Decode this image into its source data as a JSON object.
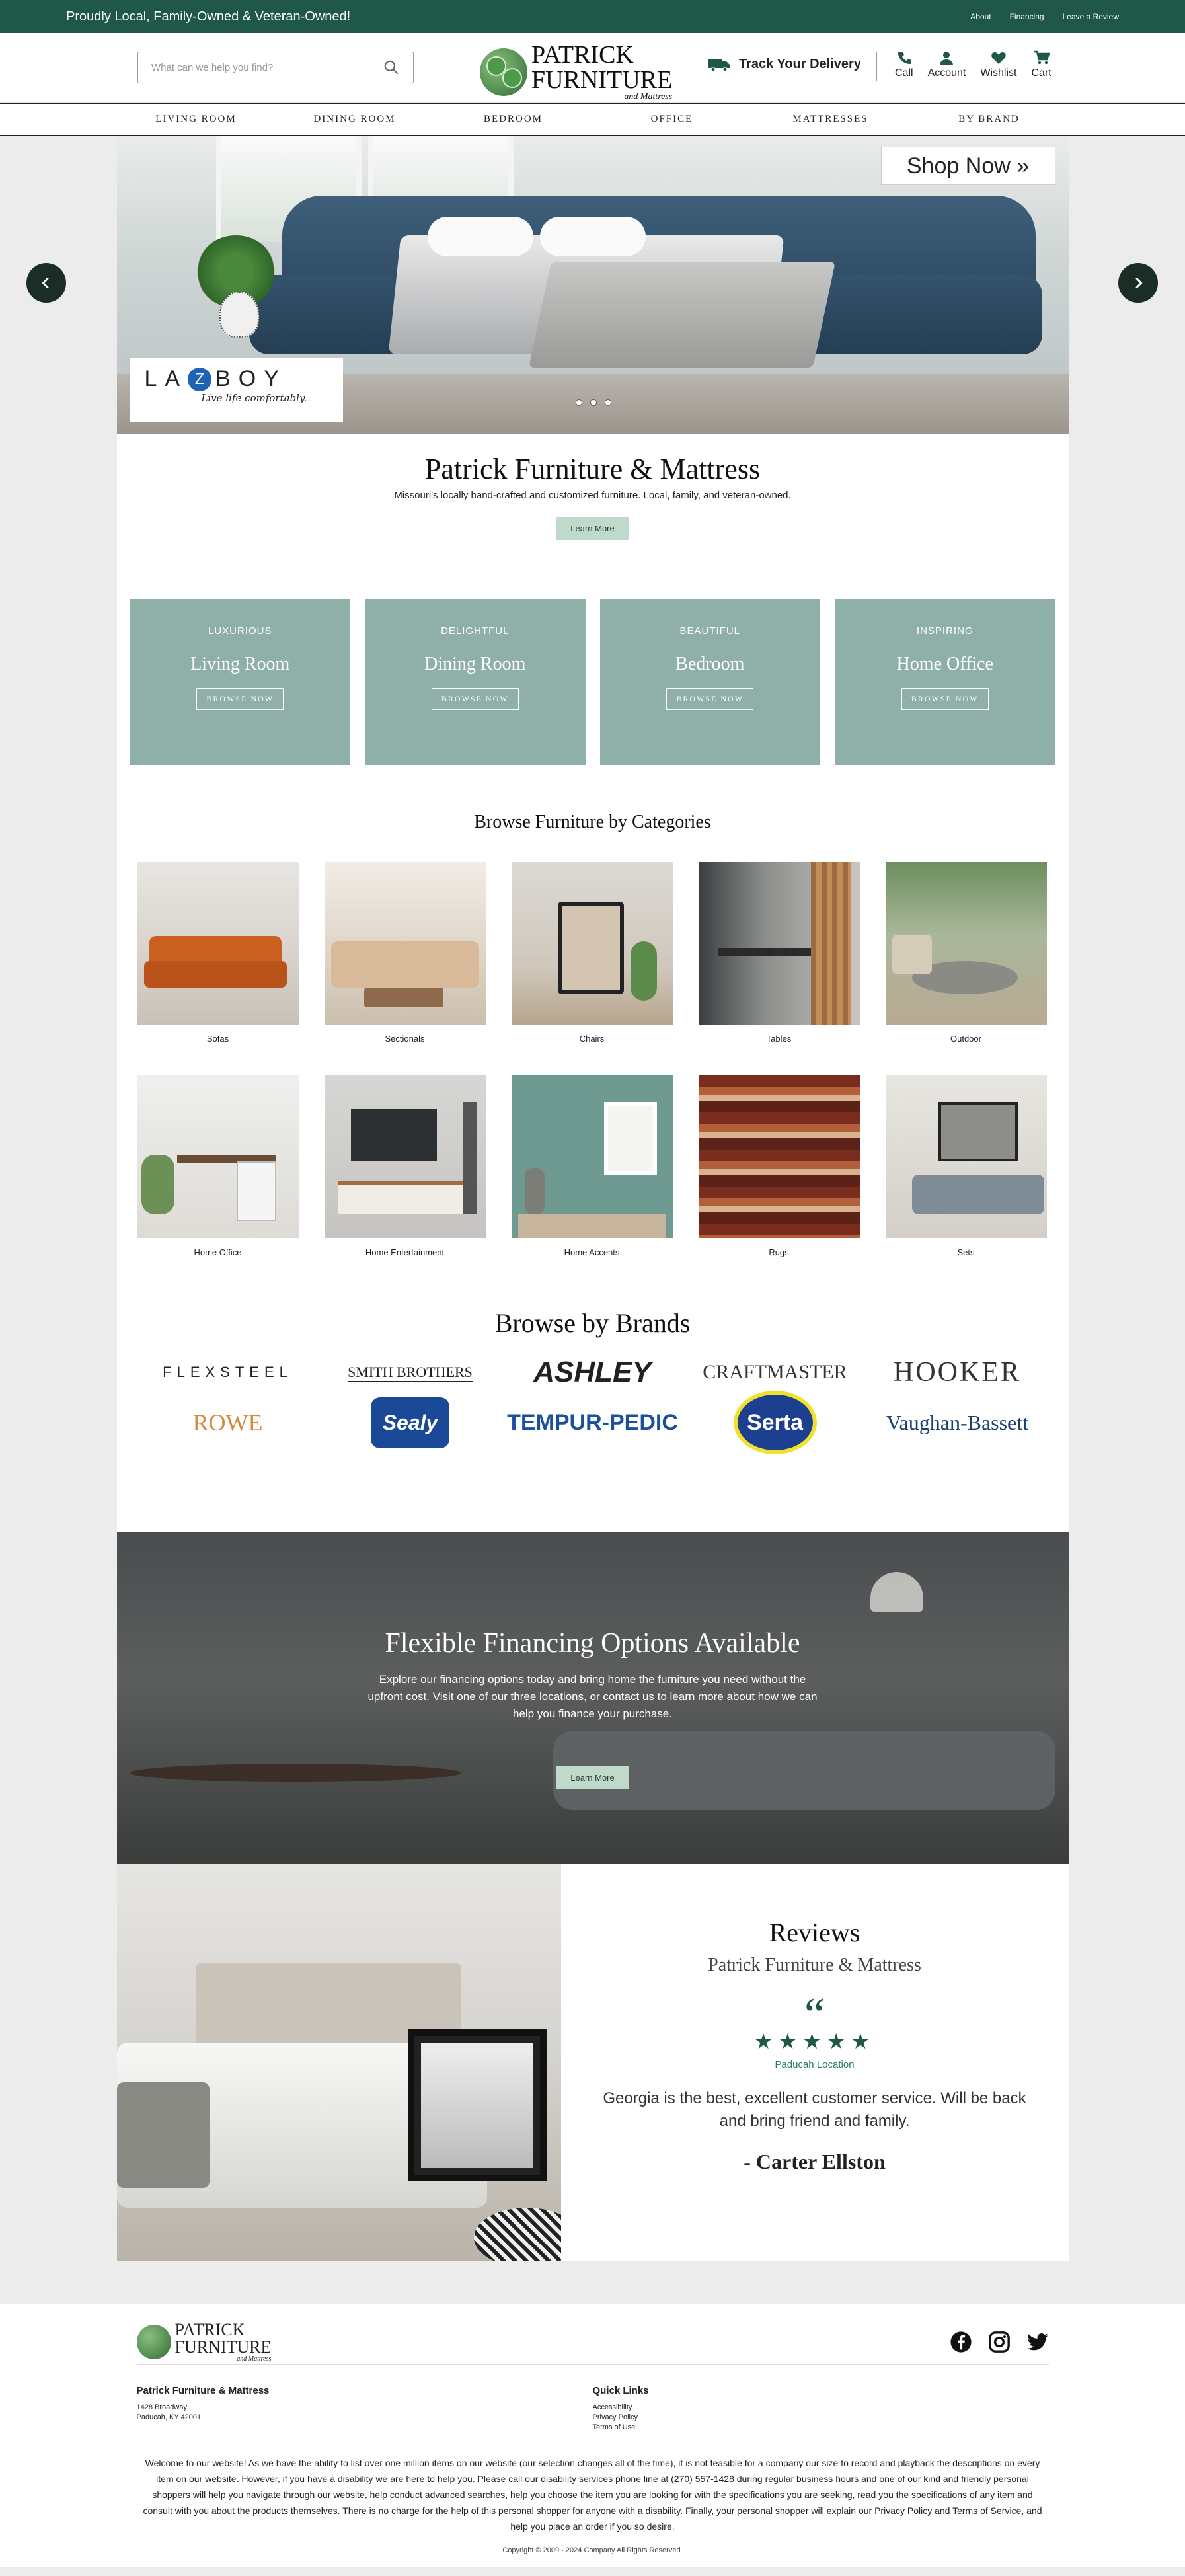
{
  "topbar": {
    "promo": "Proudly Local, Family-Owned & Veteran-Owned!",
    "links": [
      "About",
      "Financing",
      "Leave a Review"
    ]
  },
  "header": {
    "search_placeholder": "What can we help you find?",
    "logo": {
      "line1": "PATRICK",
      "line2": "FURNITURE",
      "line3": "and Mattress"
    },
    "track_delivery": "Track Your Delivery",
    "icons": [
      {
        "name": "phone-icon",
        "label": "Call"
      },
      {
        "name": "account-icon",
        "label": "Account"
      },
      {
        "name": "heart-icon",
        "label": "Wishlist"
      },
      {
        "name": "cart-icon",
        "label": "Cart"
      }
    ]
  },
  "nav": [
    "LIVING ROOM",
    "DINING ROOM",
    "BEDROOM",
    "OFFICE",
    "MATTRESSES",
    "BY BRAND"
  ],
  "hero": {
    "shop_now": "Shop Now »",
    "brand_badge": {
      "name": "LA-Z-BOY",
      "tagline": "Live life comfortably."
    },
    "slides": 3
  },
  "intro": {
    "title": "Patrick Furniture & Mattress",
    "subtitle": "Missouri's locally hand-crafted and customized furniture. Local, family, and veteran-owned.",
    "button": "Learn More"
  },
  "rooms": [
    {
      "sub": "LUXURIOUS",
      "title": "Living Room",
      "button": "BROWSE NOW"
    },
    {
      "sub": "DELIGHTFUL",
      "title": "Dining Room",
      "button": "BROWSE NOW"
    },
    {
      "sub": "BEAUTIFUL",
      "title": "Bedroom",
      "button": "BROWSE NOW"
    },
    {
      "sub": "INSPIRING",
      "title": "Home Office",
      "button": "BROWSE NOW"
    }
  ],
  "categories": {
    "title": "Browse Furniture by Categories",
    "items": [
      "Sofas",
      "Sectionals",
      "Chairs",
      "Tables",
      "Outdoor",
      "Home Office",
      "Home Entertainment",
      "Home Accents",
      "Rugs",
      "Sets"
    ]
  },
  "brands": {
    "title": "Browse by Brands",
    "items": [
      "FLEXSTEEL",
      "SMITH BROTHERS",
      "ASHLEY",
      "CRAFTMASTER",
      "HOOKER",
      "ROWE",
      "Sealy",
      "TEMPUR-PEDIC",
      "Serta",
      "Vaughan-Bassett"
    ]
  },
  "financing": {
    "title": "Flexible Financing Options Available",
    "text": "Explore our financing options today and bring home the furniture you need without the upfront cost. Visit one of our three locations, or contact us to learn more about how we can help you finance your purchase.",
    "button": "Learn More"
  },
  "reviews": {
    "title": "Reviews",
    "subtitle": "Patrick Furniture & Mattress",
    "rating": 5,
    "location": "Paducah Location",
    "text": "Georgia is the best, excellent customer service. Will be back and bring friend and family.",
    "author": "- Carter Ellston"
  },
  "footer": {
    "logo": {
      "line1": "PATRICK",
      "line2": "FURNITURE",
      "line3": "and Mattress"
    },
    "social": [
      "facebook-icon",
      "instagram-icon",
      "twitter-icon"
    ],
    "address": {
      "title": "Patrick Furniture & Mattress",
      "line1": "1428 Broadway",
      "line2": "Paducah, KY 42001"
    },
    "quick_links": {
      "title": "Quick Links",
      "items": [
        "Accessibility",
        "Privacy Policy",
        "Terms of Use"
      ]
    },
    "about": "Welcome to our website! As we have the ability to list over one million items on our website (our selection changes all of the time), it is not feasible for a company our size to record and playback the descriptions on every item on our website. However, if you have a disability we are here to help you. Please call our disability services phone line at (270) 557-1428 during regular business hours and one of our kind and friendly personal shoppers will help you navigate through our website, help conduct advanced searches, help you choose the item you are looking for with the specifications you are seeking, read you the specifications of any item and consult with you about the products themselves. There is no charge for the help of this personal shopper for anyone with a disability. Finally, your personal shopper will explain our Privacy Policy and Terms of Service, and help you place an order if you so desire.",
    "copyright": "Copyright © 2009 - 2024 Company All Rights Reserved."
  },
  "colors": {
    "brand_green": "#1f5748",
    "room_card": "#8fb0a8",
    "button_bg": "#bfd9cb"
  }
}
